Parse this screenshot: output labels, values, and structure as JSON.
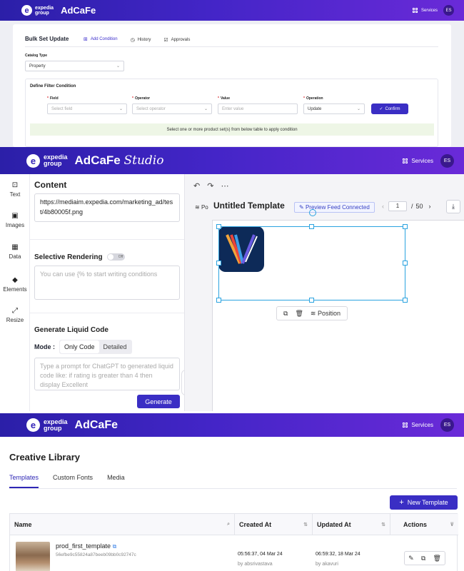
{
  "brand": {
    "logo_top": "expedia",
    "logo_bottom": "group",
    "app_name": "AdCaFe",
    "studio_suffix": "Studio",
    "services_label": "Services",
    "avatar_initials": "ES"
  },
  "bulk_set": {
    "title": "Bulk Set Update",
    "tabs": [
      {
        "label": "Add Condition",
        "active": true
      },
      {
        "label": "History"
      },
      {
        "label": "Approvals"
      }
    ],
    "catalog_type_label": "Catalog Type",
    "catalog_type_value": "Property",
    "filter_heading": "Define Filter Condition",
    "field_label": "Field",
    "field_placeholder": "Select field",
    "operator_label": "Operator",
    "operator_placeholder": "Select operator",
    "value_label": "Value",
    "value_placeholder": "Enter value",
    "operation_label": "Operation",
    "operation_value": "Update",
    "confirm_label": "Confirm",
    "info_message": "Select one or more product set(s) from below table to apply condition"
  },
  "studio": {
    "sidebar": [
      {
        "label": "Text"
      },
      {
        "label": "Images"
      },
      {
        "label": "Data"
      },
      {
        "label": "Elements"
      },
      {
        "label": "Resize"
      }
    ],
    "content_heading": "Content",
    "content_url": "https://mediaim.expedia.com/marketing_ad/test/4b80005f.png",
    "selective_rendering_label": "Selective Rendering",
    "toggle_state": "Off",
    "conditions_placeholder": "You can use {% to start writing conditions",
    "liquid_heading": "Generate Liquid Code",
    "mode_label": "Mode :",
    "mode_options": [
      "Only Code",
      "Detailed"
    ],
    "mode_selected": "Only Code",
    "prompt_placeholder": "Type a prompt for ChatGPT to generated liquid code like: if rating is greater than 4 then display Excellent",
    "generate_label": "Generate",
    "position_short": "Po",
    "template_title": "Untitled Template",
    "preview_feed_label": "Preview Feed Connected",
    "page_current": "1",
    "page_separator": "/",
    "page_total": "50",
    "floating_position_label": "Position"
  },
  "library": {
    "title": "Creative Library",
    "tabs": [
      {
        "label": "Templates",
        "active": true
      },
      {
        "label": "Custom Fonts"
      },
      {
        "label": "Media"
      }
    ],
    "new_template_label": "New Template",
    "columns": [
      "Name",
      "Created At",
      "Updated At",
      "Actions"
    ],
    "rows": [
      {
        "name": "prod_first_template",
        "id": "56efbe9c55824a87beeb09bb0c92747c",
        "created_at": "05:56:37, 04 Mar 24",
        "created_by": "by absrivastava",
        "updated_at": "06:59:32, 18 Mar 24",
        "updated_by": "by akavuri"
      }
    ]
  }
}
